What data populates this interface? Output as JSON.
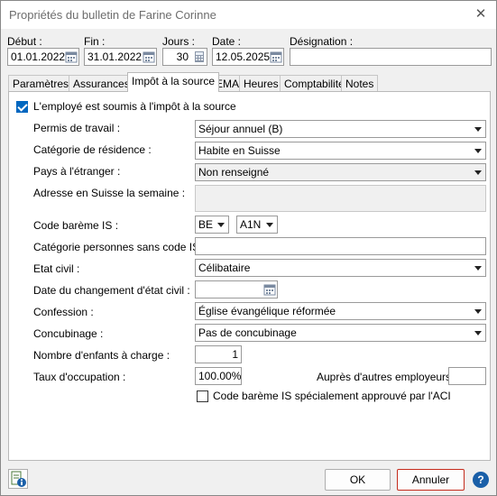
{
  "window": {
    "title": "Propriétés du bulletin de Farine Corinne",
    "close_glyph": "✕"
  },
  "header": {
    "debut_label": "Début :",
    "debut_value": "01.01.2022",
    "fin_label": "Fin :",
    "fin_value": "31.01.2022",
    "jours_label": "Jours :",
    "jours_value": "30",
    "date_label": "Date :",
    "date_value": "12.05.2025",
    "designation_label": "Désignation :",
    "designation_value": ""
  },
  "tabs": [
    "Paramètres",
    "Assurances",
    "Impôt à la source",
    "EMA",
    "Heures",
    "Comptabilité",
    "Notes"
  ],
  "active_tab": "Impôt à la source",
  "form": {
    "subject_checkbox": {
      "label": "L'employé est soumis à l'impôt à la source",
      "checked": true
    },
    "permis_label": "Permis de travail :",
    "permis_value": "Séjour annuel (B)",
    "residence_label": "Catégorie de résidence :",
    "residence_value": "Habite en Suisse",
    "pays_label": "Pays à l'étranger :",
    "pays_value": "Non renseigné",
    "adresse_label": "Adresse en Suisse la semaine :",
    "adresse_value": "",
    "bareme_label": "Code barème IS :",
    "bareme_canton": "BE",
    "bareme_code": "A1N",
    "sans_code_label": "Catégorie personnes sans code IS :",
    "sans_code_value": "",
    "etat_civil_label": "Etat civil :",
    "etat_civil_value": "Célibataire",
    "changement_label": "Date du changement d'état civil :",
    "changement_value": "",
    "confession_label": "Confession :",
    "confession_value": "Église évangélique réformée",
    "concubinage_label": "Concubinage :",
    "concubinage_value": "Pas de concubinage",
    "enfants_label": "Nombre d'enfants à charge :",
    "enfants_value": "1",
    "taux_label": "Taux d'occupation :",
    "taux_value": "100.00%",
    "autres_label": "Auprès d'autres employeurs :",
    "autres_value": "",
    "special_checkbox": {
      "label": "Code barème IS spécialement approuvé par l'ACI",
      "checked": false
    }
  },
  "footer": {
    "ok_label": "OK",
    "cancel_label": "Annuler",
    "help_glyph": "?"
  },
  "colors": {
    "accent": "#0067c0",
    "cancel_border": "#c42b1c",
    "help_bg": "#1a5fa8"
  }
}
